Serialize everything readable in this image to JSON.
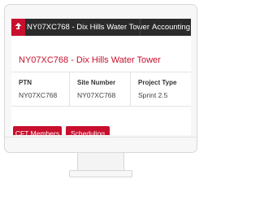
{
  "topbar": {
    "back_icon": "arrow-up-icon",
    "site_tab_label": "NY07XC768 - Dix Hills Water Tower",
    "accounting_tab_label": "Accounting"
  },
  "page": {
    "title": "NY07XC768 - Dix Hills Water Tower"
  },
  "info": [
    {
      "label": "PTN",
      "value": "NY07XC768"
    },
    {
      "label": "Site Number",
      "value": "NY07XC768"
    },
    {
      "label": "Project Type",
      "value": "Sprint 2.5"
    }
  ],
  "actions": {
    "cft_members_label": "CFT Members",
    "scheduling_label": "Scheduling"
  },
  "colors": {
    "accent": "#c8102e",
    "topbar": "#2b2b2b"
  }
}
